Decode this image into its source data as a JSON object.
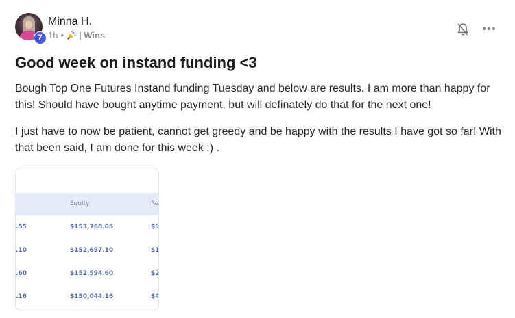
{
  "post": {
    "author": "Minna H.",
    "level": "7",
    "time": "1h",
    "separator": "•",
    "category": "| Wins",
    "title": "Good week on instand funding <3",
    "paragraphs": [
      "Bough Top One Futures Instand funding Tuesday and below are results. I am more than happy for this! Should have bought anytime payment, but will definately do that for the next one!",
      "I just have to now be patient, cannot get greedy and be happy with the results I have got so far! With that been said, I am done for this week :) ."
    ]
  },
  "icons": {
    "bell": "bell-off-icon",
    "more": "more-horizontal-icon",
    "category": "party-popper-icon"
  },
  "table_image": {
    "headers": [
      "",
      "Equity",
      "Re"
    ],
    "rows": [
      [
        "",
        ".55",
        "$153,768.05",
        "$9"
      ],
      [
        "",
        ".10",
        "$152,697.10",
        "$1("
      ],
      [
        "",
        ".60",
        "$152,594.60",
        "$2"
      ],
      [
        "",
        ".16",
        "$150,044.16",
        "$4"
      ]
    ]
  },
  "colors": {
    "level_badge": "#4458d8",
    "table_header_bg": "#e3ecf6",
    "table_text": "#5b6ba2"
  }
}
